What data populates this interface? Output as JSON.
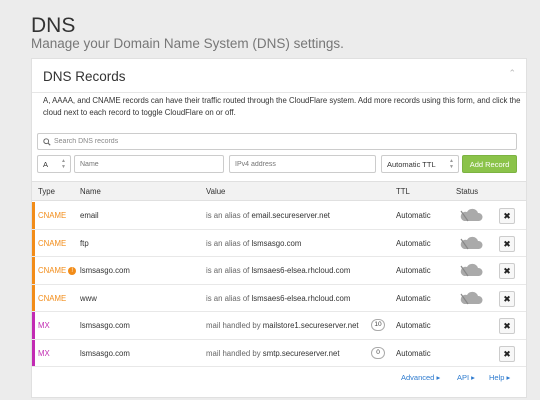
{
  "page": {
    "title": "DNS",
    "subtitle": "Manage your Domain Name System (DNS) settings."
  },
  "card": {
    "title": "DNS Records",
    "description": "A, AAAA, and CNAME records can have their traffic routed through the CloudFlare system. Add more records using this form, and click the cloud next to each record to toggle CloudFlare on or off."
  },
  "search": {
    "placeholder": "Search DNS records"
  },
  "form": {
    "type_value": "A",
    "name_placeholder": "Name",
    "ipv4_placeholder": "IPv4 address",
    "ttl_value": "Automatic TTL",
    "add_label": "Add Record"
  },
  "table": {
    "headers": {
      "type": "Type",
      "name": "Name",
      "value": "Value",
      "ttl": "TTL",
      "status": "Status"
    },
    "rows": [
      {
        "type": "CNAME",
        "name": "email",
        "value_prefix": "is an alias of",
        "value": "email.secureserver.net",
        "ttl": "Automatic",
        "priority": ""
      },
      {
        "type": "CNAME",
        "name": "ftp",
        "value_prefix": "is an alias of",
        "value": "lsmsasgo.com",
        "ttl": "Automatic",
        "priority": ""
      },
      {
        "type": "CNAME",
        "name": "lsmsasgo.com",
        "value_prefix": "is an alias of",
        "value": "lsmsaes6-elsea.rhcloud.com",
        "ttl": "Automatic",
        "priority": ""
      },
      {
        "type": "CNAME",
        "name": "www",
        "value_prefix": "is an alias of",
        "value": "lsmsaes6-elsea.rhcloud.com",
        "ttl": "Automatic",
        "priority": ""
      },
      {
        "type": "MX",
        "name": "lsmsasgo.com",
        "value_prefix": "mail handled by",
        "value": "mailstore1.secureserver.net",
        "ttl": "Automatic",
        "priority": "10"
      },
      {
        "type": "MX",
        "name": "lsmsasgo.com",
        "value_prefix": "mail handled by",
        "value": "smtp.secureserver.net",
        "ttl": "Automatic",
        "priority": "0"
      }
    ],
    "delete_glyph": "✖"
  },
  "footer": {
    "advanced": "Advanced ▸",
    "api": "API ▸",
    "help": "Help ▸"
  },
  "colors": {
    "cname": "#f28c18",
    "mx": "#c22bb3",
    "add_button": "#8bc34a",
    "link": "#2e7bcf"
  }
}
